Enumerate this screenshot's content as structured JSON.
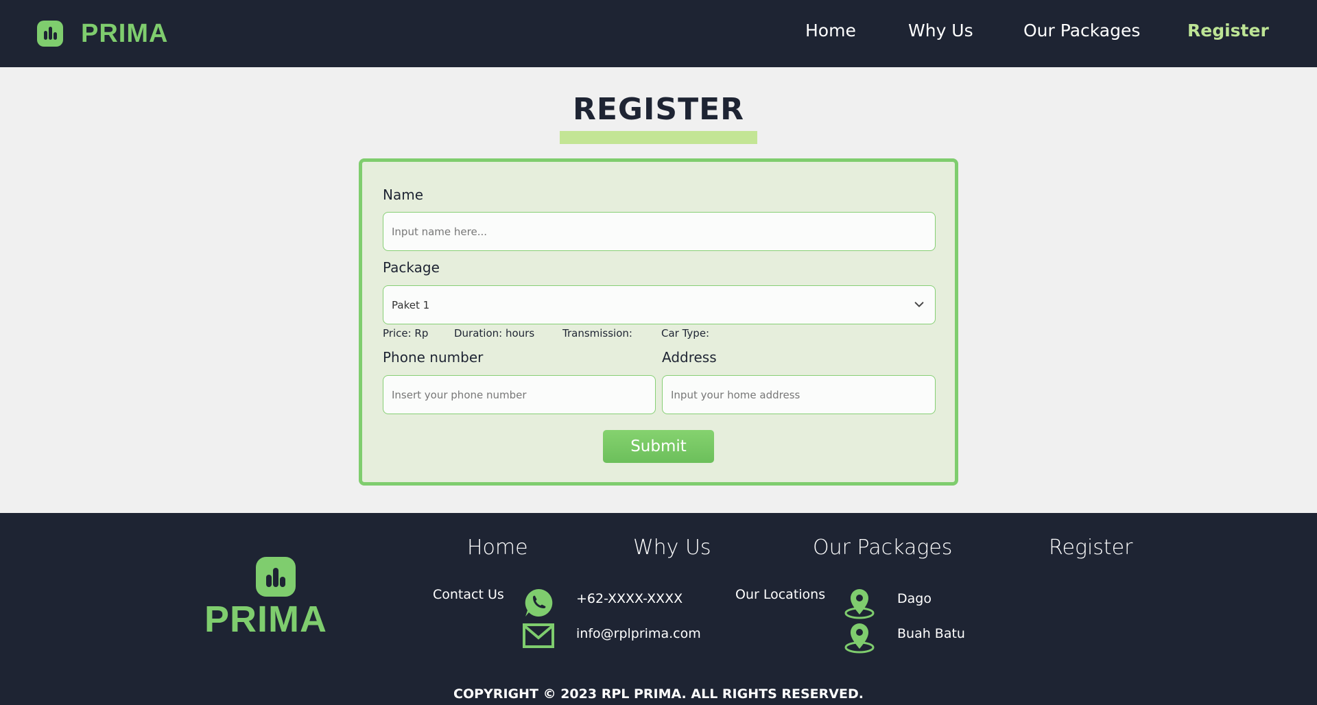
{
  "header": {
    "brand": "PRIMA",
    "nav": [
      {
        "label": "Home",
        "active": false
      },
      {
        "label": "Why Us",
        "active": false
      },
      {
        "label": "Our Packages",
        "active": false
      },
      {
        "label": "Register",
        "active": true
      }
    ]
  },
  "main": {
    "title": "REGISTER",
    "form": {
      "name_label": "Name",
      "name_placeholder": "Input name here...",
      "package_label": "Package",
      "package_selected": "Paket 1",
      "meta": {
        "price": "Price: Rp",
        "duration": "Duration: hours",
        "transmission": "Transmission:",
        "car_type": "Car Type:"
      },
      "phone_label": "Phone number",
      "phone_placeholder": "Insert your phone number",
      "address_label": "Address",
      "address_placeholder": "Input your home address",
      "submit_label": "Submit"
    }
  },
  "footer": {
    "brand": "PRIMA",
    "nav": [
      "Home",
      "Why Us",
      "Our Packages",
      "Register"
    ],
    "contact": {
      "label": "Contact Us",
      "phone": "+62-XXXX-XXXX",
      "email": "info@rplprima.com"
    },
    "locations": {
      "label": "Our Locations",
      "items": [
        "Dago",
        "Buah Batu"
      ]
    },
    "copyright": "COPYRIGHT © 2023 RPL PRIMA. ALL RIGHTS RESERVED."
  },
  "colors": {
    "navy": "#1e2433",
    "accent_green": "#7fcd6e",
    "active_nav": "#bde495",
    "form_bg": "#e6eedc"
  },
  "icons": {
    "logo": "bar-chart-logo-icon",
    "select": "chevron-down-icon",
    "whatsapp": "whatsapp-icon",
    "email": "mail-icon",
    "location": "map-pin-icon"
  }
}
